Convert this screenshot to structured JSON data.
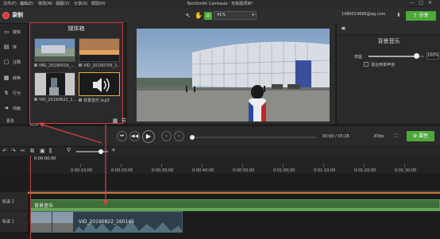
{
  "app": {
    "menu": [
      "文件(F)",
      "编辑(E)",
      "修改(M)",
      "视图(V)",
      "分享(S)",
      "帮助(H)"
    ],
    "title": "TechSmith Camtasia - 无标题项目*",
    "window_controls": [
      "—",
      "□",
      "✕"
    ]
  },
  "toolbar": {
    "record_label": "录制",
    "zoom": "41%",
    "account": "1480014685@qq.com",
    "share_label": "分享"
  },
  "tools": [
    {
      "icon": "media-icon",
      "label": "媒体"
    },
    {
      "icon": "library-icon",
      "label": "库"
    },
    {
      "icon": "annotation-icon",
      "label": "注释"
    },
    {
      "icon": "transition-icon",
      "label": "转换"
    },
    {
      "icon": "behavior-icon",
      "label": "行为"
    },
    {
      "icon": "animation-icon",
      "label": "动画"
    }
  ],
  "more_label": "更多",
  "media_bin": {
    "title": "媒体箱",
    "items": [
      {
        "name": "IMG_20190519_...",
        "kind": "image"
      },
      {
        "name": "VID_20190705_1...",
        "kind": "video"
      },
      {
        "name": "VID_20190822_1...",
        "kind": "video"
      },
      {
        "name": "背景音乐.mp3",
        "kind": "audio",
        "selected": true
      }
    ]
  },
  "properties": {
    "title": "背景音乐",
    "gain_label": "增益",
    "gain_value": "100%",
    "gain_level": 0.85,
    "mix_mono_label": "混合到单声道"
  },
  "playback": {
    "timecode": "00:00 / 05:28",
    "fps": "30fps",
    "properties_label": "属性",
    "scrub_position": 0.0
  },
  "timeline": {
    "playhead_time": "0:00:00;00",
    "ticks": [
      "0:00:00;00",
      "0:00:10;00",
      "0:00:20;00",
      "0:00:30;00",
      "0:00:40;00",
      "0:00:50;00",
      "0:01:00;00",
      "0:01:10;00",
      "0:01:20;00",
      "0:01:30;00"
    ],
    "tracks": [
      {
        "label": "轨道 2",
        "clip": "背景音乐"
      },
      {
        "label": "轨道 1",
        "clip": "VID_20190822_160145"
      }
    ]
  },
  "colors": {
    "accent_green": "#4caa3a",
    "record_red": "#d93a3a",
    "highlight_red": "#c83c3c"
  }
}
